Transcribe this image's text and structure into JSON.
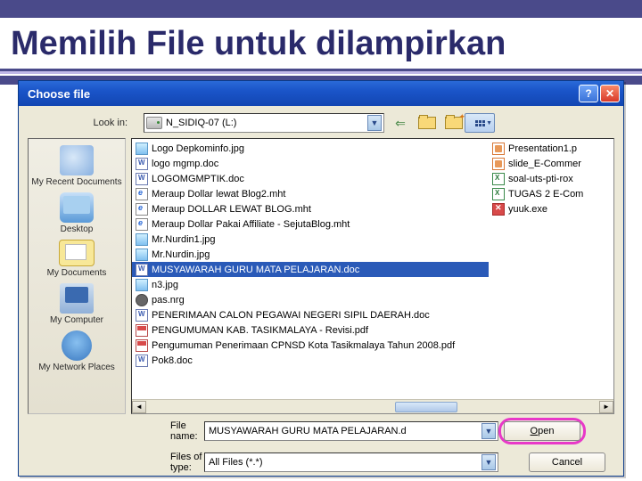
{
  "slide": {
    "title": "Memilih File untuk dilampirkan"
  },
  "dialog": {
    "title": "Choose file",
    "look_in_label": "Look in:",
    "look_in_value": "N_SIDIQ-07 (L:)",
    "file_name_label": "File name:",
    "file_name_value": "MUSYAWARAH GURU MATA PELAJARAN.d",
    "file_type_label": "Files of type:",
    "file_type_value": "All Files (*.*)",
    "open_label": "Open",
    "cancel_label": "Cancel"
  },
  "places": {
    "recent": "My Recent Documents",
    "desktop": "Desktop",
    "documents": "My Documents",
    "computer": "My Computer",
    "network": "My Network Places"
  },
  "files_left": [
    {
      "icon": "img",
      "name": "Logo Depkominfo.jpg"
    },
    {
      "icon": "doc",
      "name": "logo mgmp.doc"
    },
    {
      "icon": "doc",
      "name": "LOGOMGMPTIK.doc"
    },
    {
      "icon": "mht",
      "name": "Meraup Dollar lewat Blog2.mht"
    },
    {
      "icon": "mht",
      "name": "Meraup DOLLAR LEWAT BLOG.mht"
    },
    {
      "icon": "mht",
      "name": "Meraup Dollar Pakai Affiliate - SejutaBlog.mht"
    },
    {
      "icon": "img",
      "name": "Mr.Nurdin1.jpg"
    },
    {
      "icon": "img",
      "name": "Mr.Nurdin.jpg"
    },
    {
      "icon": "doc",
      "name": "MUSYAWARAH GURU MATA PELAJARAN.doc",
      "selected": true
    },
    {
      "icon": "img",
      "name": "n3.jpg"
    },
    {
      "icon": "nrg",
      "name": "pas.nrg"
    },
    {
      "icon": "doc",
      "name": "PENERIMAAN CALON PEGAWAI NEGERI SIPIL DAERAH.doc"
    },
    {
      "icon": "pdf",
      "name": "PENGUMUMAN KAB. TASIKMALAYA - Revisi.pdf"
    },
    {
      "icon": "pdf",
      "name": "Pengumuman Penerimaan CPNSD Kota Tasikmalaya Tahun 2008.pdf"
    },
    {
      "icon": "doc",
      "name": "Pok8.doc"
    }
  ],
  "files_right": [
    {
      "icon": "ppt",
      "name": "Presentation1.p"
    },
    {
      "icon": "ppt",
      "name": "slide_E-Commer"
    },
    {
      "icon": "xls",
      "name": "soal-uts-pti-rox"
    },
    {
      "icon": "xls",
      "name": "TUGAS 2 E-Com"
    },
    {
      "icon": "exe",
      "name": "yuuk.exe"
    }
  ]
}
